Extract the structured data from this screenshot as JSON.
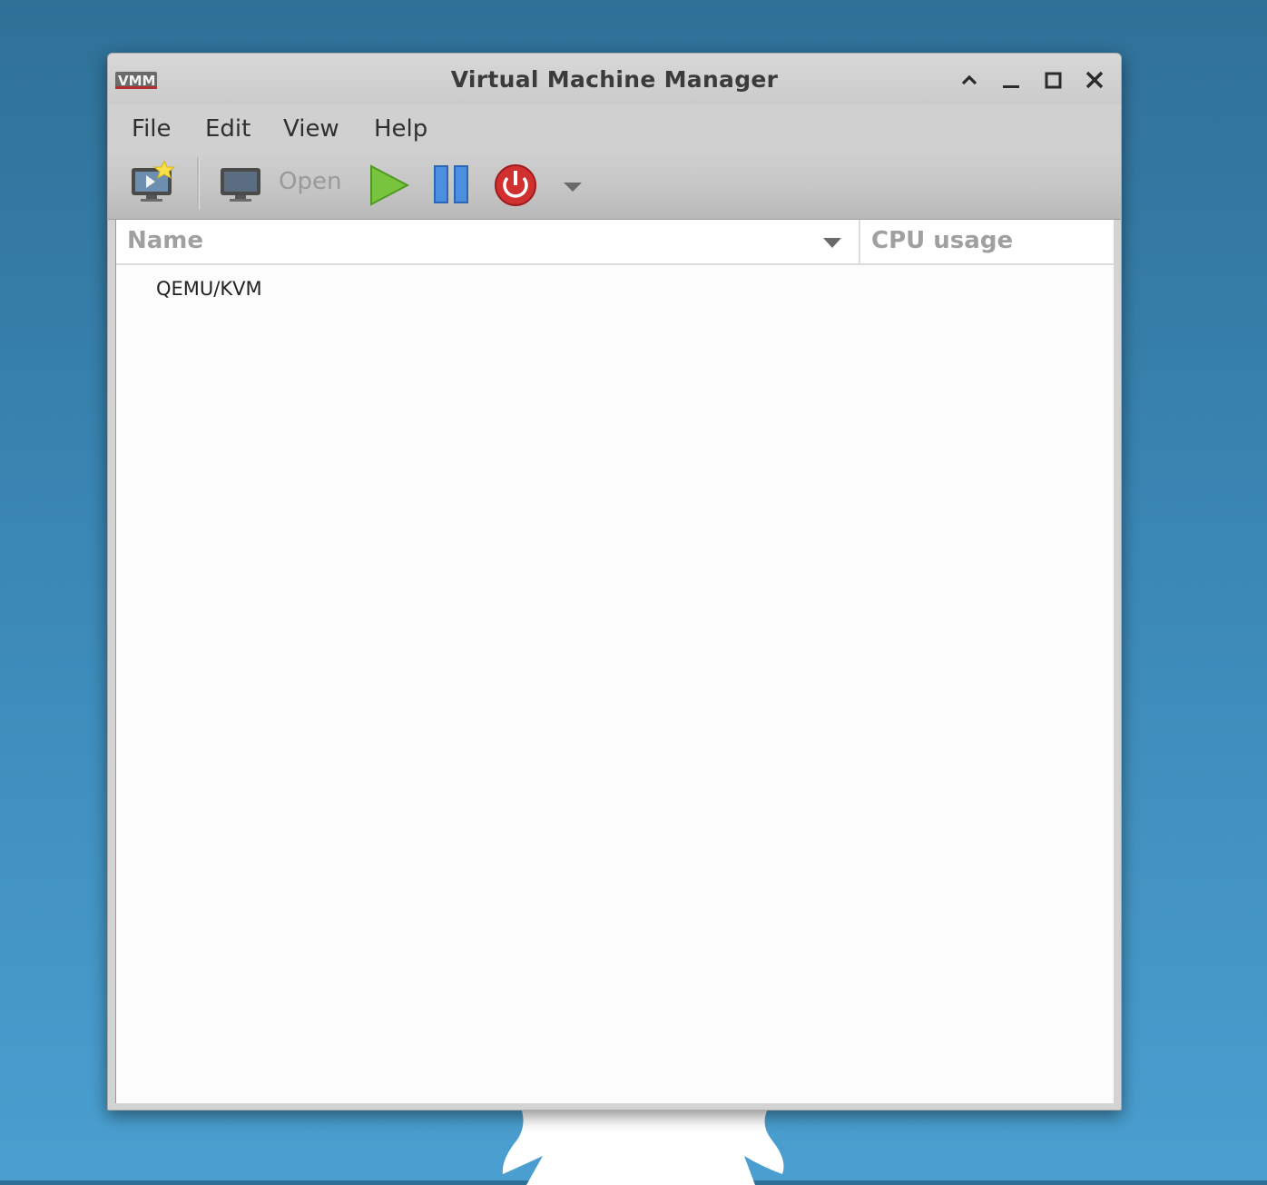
{
  "window": {
    "title": "Virtual Machine Manager"
  },
  "menubar": {
    "items": [
      "File",
      "Edit",
      "View",
      "Help"
    ]
  },
  "toolbar": {
    "open_label": "Open"
  },
  "table": {
    "columns": [
      "Name",
      "CPU usage"
    ],
    "rows": [
      {
        "name": "QEMU/KVM"
      }
    ]
  },
  "colors": {
    "desktop": "#3a86b4",
    "window_chrome": "#d3d3d3",
    "run_green": "#6fbf3a",
    "pause_blue": "#3f86dc",
    "power_red": "#cc2a2a"
  }
}
